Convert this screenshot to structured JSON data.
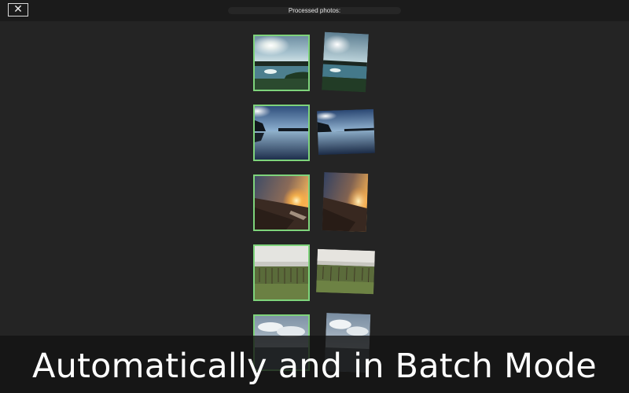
{
  "window": {
    "title": "Processed photos:",
    "close_glyph": "✕"
  },
  "caption": "Automatically and in Batch Mode",
  "colors": {
    "background": "#242424",
    "topbar": "#1b1b1b",
    "selection_border": "#7ed37b",
    "caption_text": "#ffffff"
  },
  "icons": {
    "close": "close-icon"
  }
}
